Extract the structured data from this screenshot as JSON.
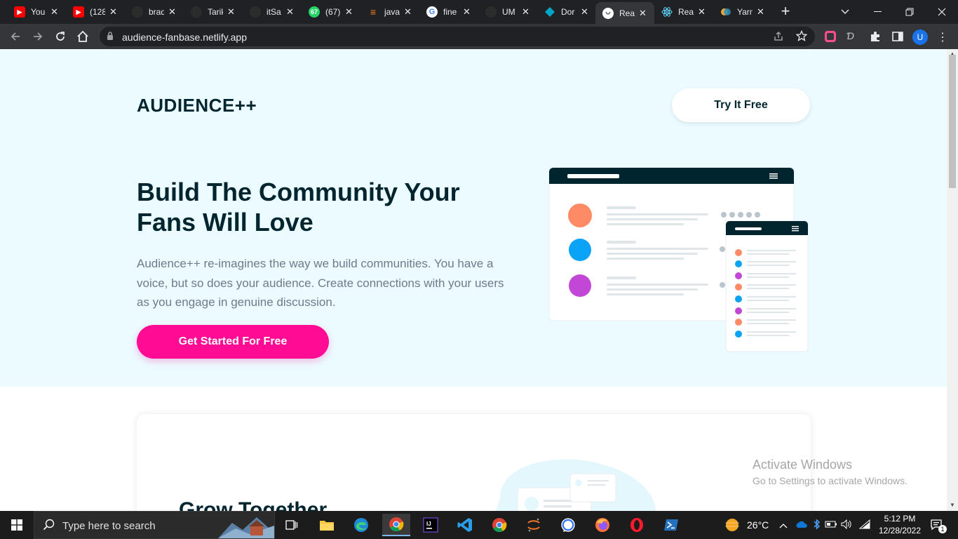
{
  "browser": {
    "tabs": [
      {
        "title": "You",
        "favicon": "youtube-icon",
        "color": "#ff0000"
      },
      {
        "title": "(128",
        "favicon": "youtube-icon",
        "color": "#ff0000"
      },
      {
        "title": "brad",
        "favicon": "github-icon",
        "color": "#202124"
      },
      {
        "title": "Tarik",
        "favicon": "github-icon",
        "color": "#202124"
      },
      {
        "title": "itSa",
        "favicon": "github-icon",
        "color": "#202124"
      },
      {
        "title": "(67)",
        "favicon": "whatsapp-icon",
        "color": "#25d366"
      },
      {
        "title": "java",
        "favicon": "stackoverflow-icon",
        "color": "#f48024"
      },
      {
        "title": "fine",
        "favicon": "google-icon",
        "color": "#4285f4"
      },
      {
        "title": "UM",
        "favicon": "github-icon",
        "color": "#202124"
      },
      {
        "title": "Dor",
        "favicon": "diamond-icon",
        "color": "#00a4c4"
      },
      {
        "title": "Rea",
        "favicon": "netlify-icon",
        "color": "#ffffff",
        "active": true
      },
      {
        "title": "Rea",
        "favicon": "react-icon",
        "color": "#61dafb"
      },
      {
        "title": "Yarn",
        "favicon": "yarn-icon",
        "color": "#2c8ebb"
      }
    ],
    "whatsapp_badge": "67",
    "url": "audience-fanbase.netlify.app",
    "profile_initial": "U"
  },
  "page": {
    "logo": "AUDIENCE++",
    "try_button": "Try It Free",
    "headline": "Build The Community Your Fans Will Love",
    "subtext": "Audience++ re-imagines the way we build communities. You have a voice, but so does your audience. Create connections with your users as you engage in genuine discussion.",
    "cta_button": "Get Started For Free",
    "section_title": "Grow Together",
    "colors": {
      "dark": "#00252e",
      "accent": "#ff0b94",
      "hero_bg": "#ebfbff",
      "body_text": "#707a8a"
    }
  },
  "watermark": {
    "line1": "Activate Windows",
    "line2": "Go to Settings to activate Windows."
  },
  "taskbar": {
    "search_placeholder": "Type here to search",
    "apps": [
      "task-view-icon",
      "file-explorer-icon",
      "edge-icon",
      "chrome-icon",
      "intellij-icon",
      "vscode-icon",
      "chrome-icon",
      "jupyter-icon",
      "signal-icon",
      "firefox-icon",
      "opera-icon",
      "powershell-icon"
    ],
    "temperature": "26°C",
    "time": "5:12 PM",
    "date": "12/28/2022",
    "notification_count": "1"
  }
}
